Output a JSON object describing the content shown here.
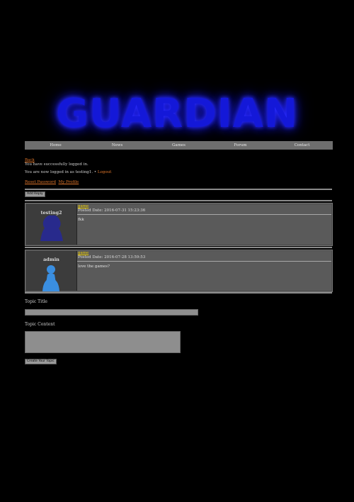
{
  "logo": {
    "text": "GUARDIAN"
  },
  "nav": {
    "items": [
      "Home",
      "News",
      "Games",
      "Forum",
      "Contact"
    ]
  },
  "back_link": "Back",
  "logout_message": "You have successfully logged in.",
  "status": {
    "prefix": "You are now logged in as testing1. •",
    "logout": "Logout"
  },
  "account_links": {
    "reset_password": "Reset Password",
    "my_profile": "My Profile"
  },
  "add_reply_button": "Add Reply",
  "posts": [
    {
      "username": "testing2",
      "title": "game",
      "date": "Posted Date: 2016-07-31 15:23:36",
      "content": "fkk",
      "avatar_color": "#282a8c"
    },
    {
      "username": "admin",
      "title": "game",
      "date": "Posted Date: 2016-07-28 13:59:53",
      "content": "love the games?",
      "avatar_color": "#3a8ee0"
    }
  ],
  "form": {
    "topic_title_label": "Topic Title",
    "topic_content_label": "Topic Content",
    "submit_label": "Create Your Topic"
  }
}
